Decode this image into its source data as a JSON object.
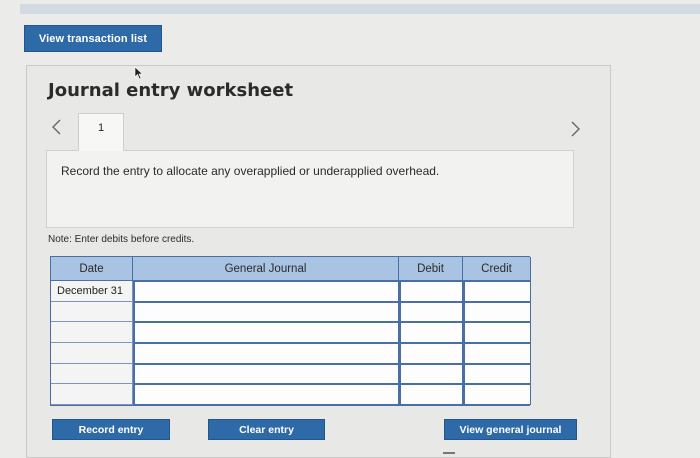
{
  "header": {
    "view_transaction_list_label": "View transaction list"
  },
  "worksheet": {
    "title": "Journal entry worksheet",
    "tabs": [
      {
        "label": "1"
      }
    ],
    "instruction": "Record the entry to allocate any overapplied or underapplied overhead.",
    "note": "Note: Enter debits before credits."
  },
  "table": {
    "columns": [
      "Date",
      "General Journal",
      "Debit",
      "Credit"
    ],
    "rows": [
      {
        "date": "December 31",
        "account": "",
        "debit": "",
        "credit": ""
      },
      {
        "date": "",
        "account": "",
        "debit": "",
        "credit": ""
      },
      {
        "date": "",
        "account": "",
        "debit": "",
        "credit": ""
      },
      {
        "date": "",
        "account": "",
        "debit": "",
        "credit": ""
      },
      {
        "date": "",
        "account": "",
        "debit": "",
        "credit": ""
      },
      {
        "date": "",
        "account": "",
        "debit": "",
        "credit": ""
      }
    ]
  },
  "buttons": {
    "record_entry": "Record entry",
    "clear_entry": "Clear entry",
    "view_general_journal": "View general journal"
  },
  "colors": {
    "button_blue": "#2f6aa8",
    "table_header": "#a9c3e3",
    "table_border": "#4a6fa5"
  },
  "icons": [
    "chevron-left-icon",
    "chevron-right-icon",
    "mouse-cursor-icon"
  ]
}
